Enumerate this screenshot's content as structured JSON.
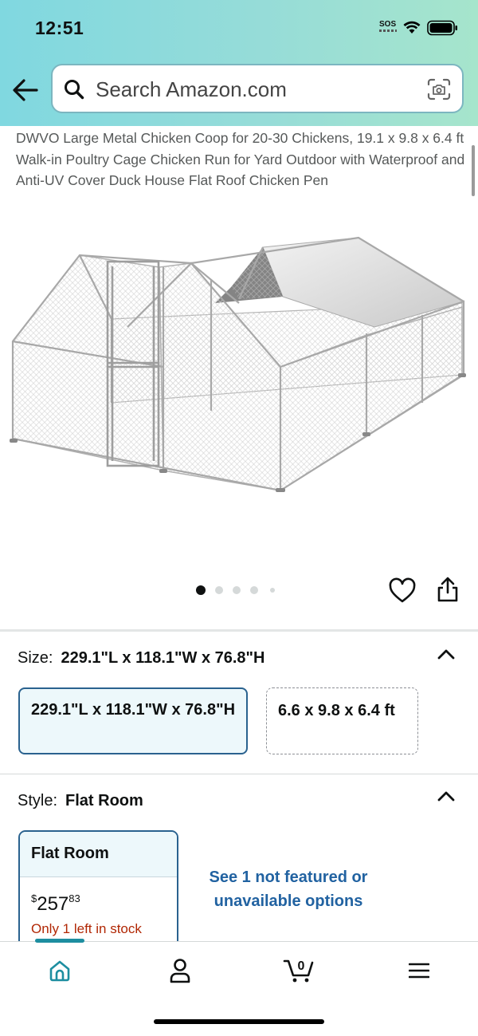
{
  "status_bar": {
    "time": "12:51",
    "sos": "SOS"
  },
  "search": {
    "placeholder": "Search Amazon.com"
  },
  "product": {
    "title": "DWVO Large Metal Chicken Coop for 20-30 Chickens, 19.1 x 9.8 x 6.4 ft Walk-in Poultry Cage Chicken Run for Yard Outdoor with Waterproof and Anti-UV Cover Duck House Flat Roof Chicken Pen",
    "image_icon": "chicken-coop-image",
    "image_count": 5,
    "current_image_index": 1
  },
  "size": {
    "label": "Size:",
    "selected_value": "229.1\"L x 118.1\"W x 76.8\"H",
    "options": [
      {
        "label": "229.1\"L x 118.1\"W x 76.8\"H",
        "selected": true
      },
      {
        "label": "6.6 x 9.8 x 6.4 ft",
        "selected": false
      }
    ]
  },
  "style": {
    "label": "Style:",
    "selected_value": "Flat Room",
    "card": {
      "name": "Flat Room",
      "price_currency": "$",
      "price_whole": "257",
      "price_fraction": "83",
      "stock": "Only 1 left in stock"
    },
    "see_more": "See 1 not featured or unavailable options"
  },
  "bottom_nav": {
    "items": [
      "home-icon",
      "account-icon",
      "cart-icon",
      "menu-icon"
    ],
    "active": "home-icon",
    "cart_count": "0"
  },
  "colors": {
    "header_gradient_start": "#80d8e0",
    "header_gradient_end": "#a6e5cc",
    "selected_border": "#2a628f",
    "selected_bg": "#edf8fb",
    "link": "#2162a1",
    "stock_warning": "#b12704",
    "nav_accent": "#1d8ea0"
  }
}
